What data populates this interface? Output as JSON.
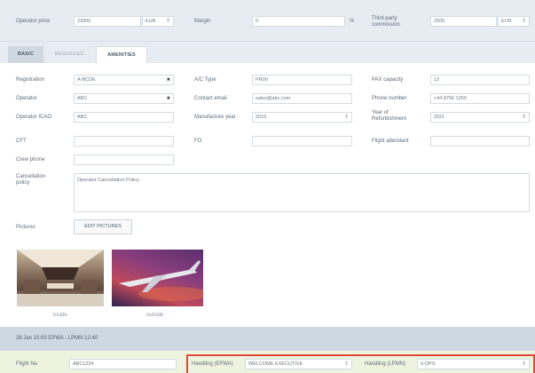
{
  "top": {
    "operator_price_label": "Operator price",
    "operator_price_value": "23000",
    "operator_price_currency": "EUR",
    "margin_label": "Margin",
    "margin_value": "0",
    "margin_unit": "%",
    "third_party_label_1": "Third party",
    "third_party_label_2": "commission",
    "third_party_value": "2500",
    "third_party_currency": "EUR"
  },
  "tabs": [
    "BASIC",
    "MESSAGES",
    "AMENITIES"
  ],
  "basic": {
    "registration_label": "Registration",
    "registration_value": "A-BCDE",
    "operator_label": "Operator",
    "operator_value": "ABC",
    "operator_icao_label": "Operator ICAO",
    "operator_icao_value": "ABC",
    "cft_label": "CFT",
    "cft_value": "",
    "crew_phone_label": "Crew phone",
    "crew_phone_value": "",
    "cancellation_label_1": "Cancellation",
    "cancellation_label_2": "policy",
    "cancellation_value": "Operator Cancellation Policy",
    "ac_type_label": "A/C Type",
    "ac_type_value": "PR00",
    "contact_email_label": "Contact email",
    "contact_email_value": "sales@abc.com",
    "manufacture_year_label": "Manufacture year",
    "manufacture_year_value": "2019",
    "fo_label": "FO",
    "fo_value": "",
    "pax_capacity_label": "PAX capacity",
    "pax_capacity_value": "12",
    "phone_number_label": "Phone number",
    "phone_number_value": "+44 8756 1260",
    "year_refurb_label_1": "Year of",
    "year_refurb_label_2": "Refurbishment",
    "year_refurb_value": "2021",
    "flight_attendant_label": "Flight attendant",
    "flight_attendant_value": ""
  },
  "pictures": {
    "label": "Pictures",
    "edit_button": "EDIT PICTURES",
    "caption_inside": "inside",
    "caption_outside": "outside"
  },
  "flight": {
    "header": "28 Jan 10:00 EPWA - LPMN 12:40",
    "flight_no_label": "Flight No",
    "flight_no_value": "ABC1234",
    "handling_dep_label": "Handling (EPWA)",
    "handling_dep_value": "WELCOME EXECUTIVE",
    "handling_arr_label": "Handling (LPMN)",
    "handling_arr_value": "6-OPS"
  }
}
